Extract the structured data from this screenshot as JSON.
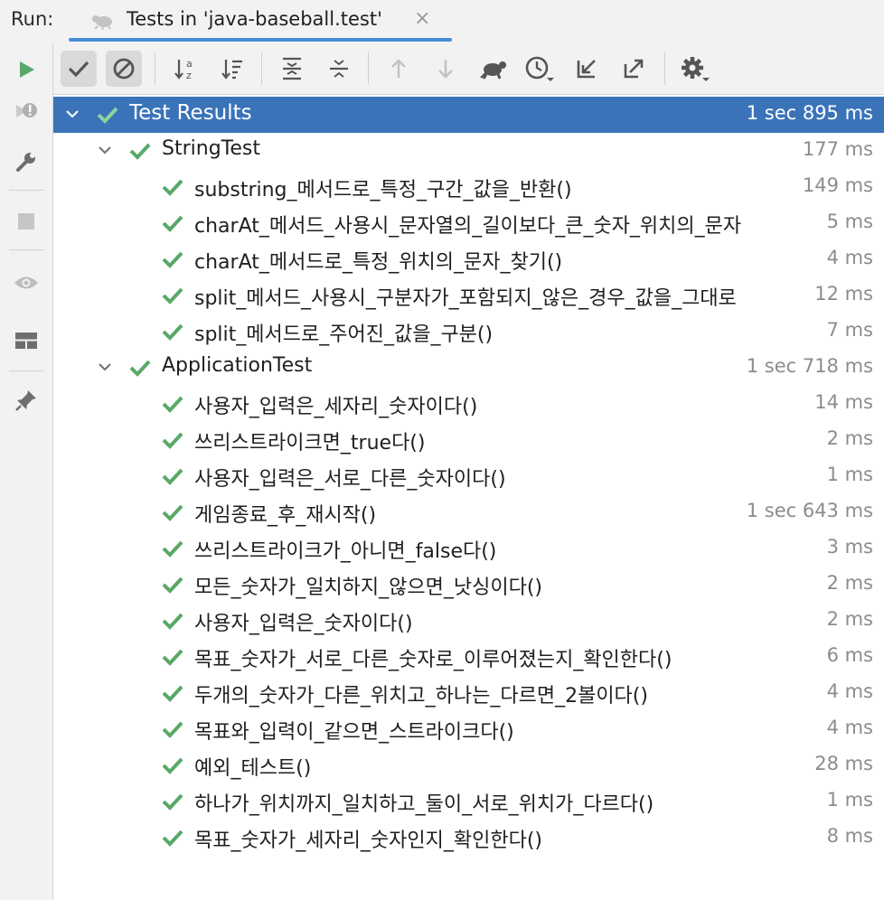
{
  "run_label": "Run:",
  "tab": {
    "title": "Tests in 'java-baseball.test'",
    "icon": "bug-icon",
    "close": "×"
  },
  "colors": {
    "accent": "#3b73b9",
    "pass": "#59a869",
    "tab_underline": "#4a8cd6"
  },
  "root": {
    "label": "Test Results",
    "time": "1 sec 895 ms"
  },
  "groups": [
    {
      "label": "StringTest",
      "time": "177 ms",
      "tests": [
        {
          "label": "substring_메서드로_특정_구간_값을_반환()",
          "time": "149 ms"
        },
        {
          "label": "charAt_메서드_사용시_문자열의_길이보다_큰_숫자_위치의_문자",
          "time": "5 ms"
        },
        {
          "label": "charAt_메서드로_특정_위치의_문자_찾기()",
          "time": "4 ms"
        },
        {
          "label": "split_메서드_사용시_구분자가_포함되지_않은_경우_값을_그대로",
          "time": "12 ms"
        },
        {
          "label": "split_메서드로_주어진_값을_구분()",
          "time": "7 ms"
        }
      ]
    },
    {
      "label": "ApplicationTest",
      "time": "1 sec 718 ms",
      "tests": [
        {
          "label": "사용자_입력은_세자리_숫자이다()",
          "time": "14 ms"
        },
        {
          "label": "쓰리스트라이크면_true다()",
          "time": "2 ms"
        },
        {
          "label": "사용자_입력은_서로_다른_숫자이다()",
          "time": "1 ms"
        },
        {
          "label": "게임종료_후_재시작()",
          "time": "1 sec 643 ms"
        },
        {
          "label": "쓰리스트라이크가_아니면_false다()",
          "time": "3 ms"
        },
        {
          "label": "모든_숫자가_일치하지_않으면_낫싱이다()",
          "time": "2 ms"
        },
        {
          "label": "사용자_입력은_숫자이다()",
          "time": "2 ms"
        },
        {
          "label": "목표_숫자가_서로_다른_숫자로_이루어졌는지_확인한다()",
          "time": "6 ms"
        },
        {
          "label": "두개의_숫자가_다른_위치고_하나는_다르면_2볼이다()",
          "time": "4 ms"
        },
        {
          "label": "목표와_입력이_같으면_스트라이크다()",
          "time": "4 ms"
        },
        {
          "label": "예외_테스트()",
          "time": "28 ms"
        },
        {
          "label": "하나가_위치까지_일치하고_둘이_서로_위치가_다르다()",
          "time": "1 ms"
        },
        {
          "label": "목표_숫자가_세자리_숫자인지_확인한다()",
          "time": "8 ms"
        }
      ]
    }
  ]
}
